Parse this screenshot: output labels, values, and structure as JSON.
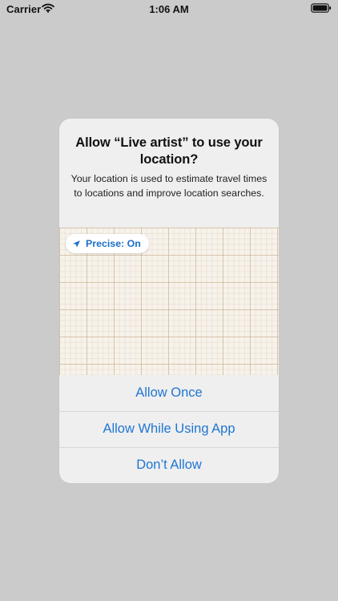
{
  "status_bar": {
    "carrier": "Carrier",
    "time": "1:06 AM",
    "icons": {
      "wifi": "wifi-icon",
      "battery": "battery-icon"
    }
  },
  "alert": {
    "title": "Allow “Live artist” to use your location?",
    "message": "Your location is used to estimate travel times to locations and improve location searches.",
    "precise_label": "Precise: On",
    "precise_icon": "location-arrow-icon",
    "buttons": [
      {
        "label": "Allow Once"
      },
      {
        "label": "Allow While Using App"
      },
      {
        "label": "Don’t Allow"
      }
    ]
  },
  "colors": {
    "background": "#cbcbcb",
    "dialog": "#efefef",
    "accent": "#1f76d2",
    "map": "#f7f2ea"
  }
}
